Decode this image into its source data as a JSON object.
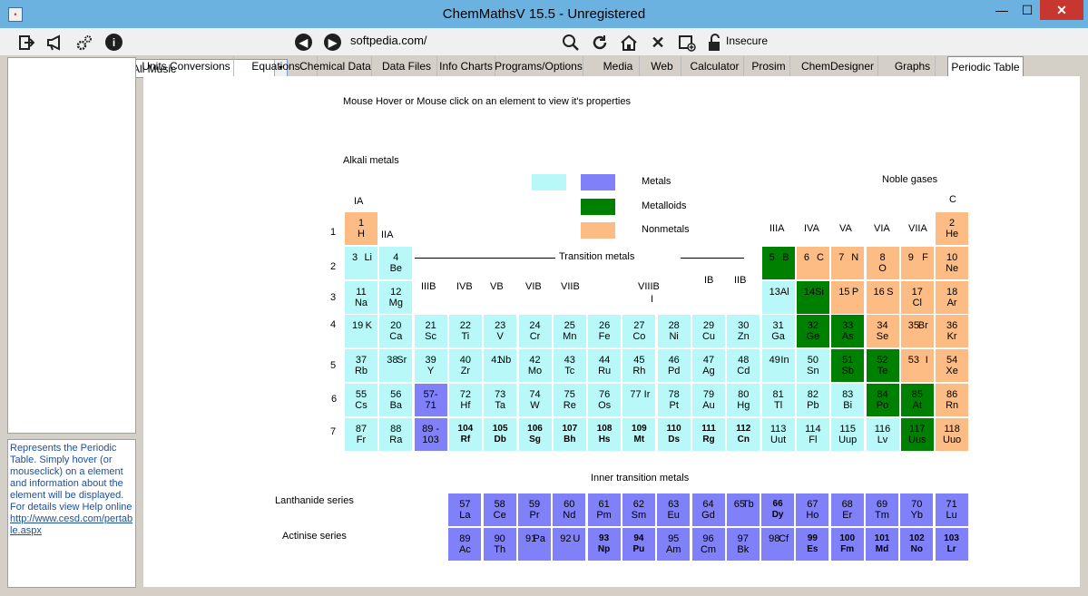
{
  "window": {
    "title": "ChemMathsV 15.5 - Unregistered",
    "min": "—",
    "max": "☐",
    "close": "✕",
    "app_icon": "•"
  },
  "toolbar": {
    "icons": [
      "exit-icon",
      "megaphone-icon",
      "gears-icon",
      "info-icon"
    ],
    "combo_value": "All Music",
    "url": "softpedia.com/",
    "nav_icons": [
      "back-icon",
      "forward-icon",
      "search-icon",
      "refresh-icon",
      "home-icon",
      "stop-icon",
      "new-tab-icon",
      "lock-icon"
    ],
    "insecure_label": "Insecure"
  },
  "help": {
    "text": "Represents the Periodic Table. Simply hover (or mouseclick) on a element and information about the element will be displayed. For details view Help online",
    "link": "http://www.cesd.com/pertable.aspx"
  },
  "tabs": [
    "Units Conversions",
    "Equations",
    "Chemical Data",
    "Data Files",
    "Info Charts",
    "Programs/Options",
    "Media",
    "Web",
    "Calculator",
    "Prosim",
    "ChemDesigner",
    "Graphs",
    "Periodic Table"
  ],
  "active_tab": "Periodic Table",
  "periodic": {
    "instruction": "Mouse Hover or Mouse click on an element to view it's properties",
    "alkali_label": "Alkali metals",
    "noble_label": "Noble gases",
    "legend": {
      "metals": "Metals",
      "metalloids": "Metalloids",
      "nonmetals": "Nonmetals"
    },
    "transition_label": "Transition metals",
    "inner_label": "Inner transition metals",
    "lanthanide_label": "Lanthanide series",
    "actinide_label": "Actinise series",
    "group_labels": [
      "IA",
      "IIA",
      "IIIB",
      "IVB",
      "VB",
      "VIB",
      "VIIB",
      "VIIIB",
      "I",
      "IB",
      "IIB",
      "IIIA",
      "IVA",
      "VA",
      "VIA",
      "VIIA",
      "C"
    ],
    "period_labels": [
      "1",
      "2",
      "3",
      "4",
      "5",
      "6",
      "7"
    ],
    "colors": {
      "metal": "#b8f8f8",
      "inner": "#8080f8",
      "metalloid": "#008000",
      "nonmetal": "#fcbc84"
    },
    "elements": [
      {
        "n": "1",
        "s": "H",
        "c": "nonmetal",
        "r": 1,
        "g": 1
      },
      {
        "n": "2",
        "s": "He",
        "c": "nonmetal",
        "r": 1,
        "g": 18
      },
      {
        "n": "3",
        "s": "Li",
        "c": "metal",
        "r": 2,
        "g": 1,
        "inl": 1
      },
      {
        "n": "4",
        "s": "Be",
        "c": "metal",
        "r": 2,
        "g": 2
      },
      {
        "n": "5",
        "s": "B",
        "c": "metalloid",
        "r": 2,
        "g": 13,
        "inl": 1
      },
      {
        "n": "6",
        "s": "C",
        "c": "nonmetal",
        "r": 2,
        "g": 14,
        "inl": 1
      },
      {
        "n": "7",
        "s": "N",
        "c": "nonmetal",
        "r": 2,
        "g": 15,
        "inl": 1
      },
      {
        "n": "8",
        "s": "O",
        "c": "nonmetal",
        "r": 2,
        "g": 16
      },
      {
        "n": "9",
        "s": "F",
        "c": "nonmetal",
        "r": 2,
        "g": 17,
        "inl": 1
      },
      {
        "n": "10",
        "s": "Ne",
        "c": "nonmetal",
        "r": 2,
        "g": 18
      },
      {
        "n": "11",
        "s": "Na",
        "c": "metal",
        "r": 3,
        "g": 1
      },
      {
        "n": "12",
        "s": "Mg",
        "c": "metal",
        "r": 3,
        "g": 2
      },
      {
        "n": "13",
        "s": "Al",
        "c": "metal",
        "r": 3,
        "g": 13,
        "inl": 1
      },
      {
        "n": "14",
        "s": "Si",
        "c": "metalloid",
        "r": 3,
        "g": 14,
        "inl": 1
      },
      {
        "n": "15",
        "s": "P",
        "c": "nonmetal",
        "r": 3,
        "g": 15,
        "inl": 1
      },
      {
        "n": "16",
        "s": "S",
        "c": "nonmetal",
        "r": 3,
        "g": 16,
        "inl": 1
      },
      {
        "n": "17",
        "s": "Cl",
        "c": "nonmetal",
        "r": 3,
        "g": 17
      },
      {
        "n": "18",
        "s": "Ar",
        "c": "nonmetal",
        "r": 3,
        "g": 18
      },
      {
        "n": "19",
        "s": "K",
        "c": "metal",
        "r": 4,
        "g": 1,
        "inl": 1
      },
      {
        "n": "20",
        "s": "Ca",
        "c": "metal",
        "r": 4,
        "g": 2
      },
      {
        "n": "21",
        "s": "Sc",
        "c": "metal",
        "r": 4,
        "g": 3
      },
      {
        "n": "22",
        "s": "Ti",
        "c": "metal",
        "r": 4,
        "g": 4
      },
      {
        "n": "23",
        "s": "V",
        "c": "metal",
        "r": 4,
        "g": 5
      },
      {
        "n": "24",
        "s": "Cr",
        "c": "metal",
        "r": 4,
        "g": 6
      },
      {
        "n": "25",
        "s": "Mn",
        "c": "metal",
        "r": 4,
        "g": 7
      },
      {
        "n": "26",
        "s": "Fe",
        "c": "metal",
        "r": 4,
        "g": 8
      },
      {
        "n": "27",
        "s": "Co",
        "c": "metal",
        "r": 4,
        "g": 9
      },
      {
        "n": "28",
        "s": "Ni",
        "c": "metal",
        "r": 4,
        "g": 10
      },
      {
        "n": "29",
        "s": "Cu",
        "c": "metal",
        "r": 4,
        "g": 11
      },
      {
        "n": "30",
        "s": "Zn",
        "c": "metal",
        "r": 4,
        "g": 12
      },
      {
        "n": "31",
        "s": "Ga",
        "c": "metal",
        "r": 4,
        "g": 13
      },
      {
        "n": "32",
        "s": "Ge",
        "c": "metalloid",
        "r": 4,
        "g": 14
      },
      {
        "n": "33",
        "s": "As",
        "c": "metalloid",
        "r": 4,
        "g": 15
      },
      {
        "n": "34",
        "s": "Se",
        "c": "nonmetal",
        "r": 4,
        "g": 16
      },
      {
        "n": "35",
        "s": "Br",
        "c": "nonmetal",
        "r": 4,
        "g": 17,
        "inl": 1
      },
      {
        "n": "36",
        "s": "Kr",
        "c": "nonmetal",
        "r": 4,
        "g": 18
      },
      {
        "n": "37",
        "s": "Rb",
        "c": "metal",
        "r": 5,
        "g": 1
      },
      {
        "n": "38",
        "s": "Sr",
        "c": "metal",
        "r": 5,
        "g": 2,
        "inl": 1
      },
      {
        "n": "39",
        "s": "Y",
        "c": "metal",
        "r": 5,
        "g": 3
      },
      {
        "n": "40",
        "s": "Zr",
        "c": "metal",
        "r": 5,
        "g": 4
      },
      {
        "n": "41",
        "s": "Nb",
        "c": "metal",
        "r": 5,
        "g": 5,
        "inl": 1
      },
      {
        "n": "42",
        "s": "Mo",
        "c": "metal",
        "r": 5,
        "g": 6
      },
      {
        "n": "43",
        "s": "Tc",
        "c": "metal",
        "r": 5,
        "g": 7
      },
      {
        "n": "44",
        "s": "Ru",
        "c": "metal",
        "r": 5,
        "g": 8
      },
      {
        "n": "45",
        "s": "Rh",
        "c": "metal",
        "r": 5,
        "g": 9
      },
      {
        "n": "46",
        "s": "Pd",
        "c": "metal",
        "r": 5,
        "g": 10
      },
      {
        "n": "47",
        "s": "Ag",
        "c": "metal",
        "r": 5,
        "g": 11
      },
      {
        "n": "48",
        "s": "Cd",
        "c": "metal",
        "r": 5,
        "g": 12
      },
      {
        "n": "49",
        "s": "In",
        "c": "metal",
        "r": 5,
        "g": 13,
        "inl": 1
      },
      {
        "n": "50",
        "s": "Sn",
        "c": "metal",
        "r": 5,
        "g": 14
      },
      {
        "n": "51",
        "s": "Sb",
        "c": "metalloid",
        "r": 5,
        "g": 15
      },
      {
        "n": "52",
        "s": "Te",
        "c": "metalloid",
        "r": 5,
        "g": 16
      },
      {
        "n": "53",
        "s": "I",
        "c": "nonmetal",
        "r": 5,
        "g": 17,
        "inl": 1
      },
      {
        "n": "54",
        "s": "Xe",
        "c": "nonmetal",
        "r": 5,
        "g": 18
      },
      {
        "n": "55",
        "s": "Cs",
        "c": "metal",
        "r": 6,
        "g": 1
      },
      {
        "n": "56",
        "s": "Ba",
        "c": "metal",
        "r": 6,
        "g": 2
      },
      {
        "n": "57-",
        "s": "71",
        "c": "inner",
        "r": 6,
        "g": 3
      },
      {
        "n": "72",
        "s": "Hf",
        "c": "metal",
        "r": 6,
        "g": 4
      },
      {
        "n": "73",
        "s": "Ta",
        "c": "metal",
        "r": 6,
        "g": 5
      },
      {
        "n": "74",
        "s": "W",
        "c": "metal",
        "r": 6,
        "g": 6
      },
      {
        "n": "75",
        "s": "Re",
        "c": "metal",
        "r": 6,
        "g": 7
      },
      {
        "n": "76",
        "s": "Os",
        "c": "metal",
        "r": 6,
        "g": 8
      },
      {
        "n": "77",
        "s": "Ir",
        "c": "metal",
        "r": 6,
        "g": 9,
        "inl": 1
      },
      {
        "n": "78",
        "s": "Pt",
        "c": "metal",
        "r": 6,
        "g": 10
      },
      {
        "n": "79",
        "s": "Au",
        "c": "metal",
        "r": 6,
        "g": 11
      },
      {
        "n": "80",
        "s": "Hg",
        "c": "metal",
        "r": 6,
        "g": 12
      },
      {
        "n": "81",
        "s": "Tl",
        "c": "metal",
        "r": 6,
        "g": 13
      },
      {
        "n": "82",
        "s": "Pb",
        "c": "metal",
        "r": 6,
        "g": 14
      },
      {
        "n": "83",
        "s": "Bi",
        "c": "metal",
        "r": 6,
        "g": 15
      },
      {
        "n": "84",
        "s": "Po",
        "c": "metalloid",
        "r": 6,
        "g": 16
      },
      {
        "n": "85",
        "s": "At",
        "c": "metalloid",
        "r": 6,
        "g": 17
      },
      {
        "n": "86",
        "s": "Rn",
        "c": "nonmetal",
        "r": 6,
        "g": 18
      },
      {
        "n": "87",
        "s": "Fr",
        "c": "metal",
        "r": 7,
        "g": 1
      },
      {
        "n": "88",
        "s": "Ra",
        "c": "metal",
        "r": 7,
        "g": 2
      },
      {
        "n": "89 -",
        "s": "103",
        "c": "inner",
        "r": 7,
        "g": 3
      },
      {
        "n": "104",
        "s": "Rf",
        "c": "metal",
        "r": 7,
        "g": 4,
        "b": 1
      },
      {
        "n": "105",
        "s": "Db",
        "c": "metal",
        "r": 7,
        "g": 5,
        "b": 1
      },
      {
        "n": "106",
        "s": "Sg",
        "c": "metal",
        "r": 7,
        "g": 6,
        "b": 1
      },
      {
        "n": "107",
        "s": "Bh",
        "c": "metal",
        "r": 7,
        "g": 7,
        "b": 1
      },
      {
        "n": "108",
        "s": "Hs",
        "c": "metal",
        "r": 7,
        "g": 8,
        "b": 1
      },
      {
        "n": "109",
        "s": "Mt",
        "c": "metal",
        "r": 7,
        "g": 9,
        "b": 1
      },
      {
        "n": "110",
        "s": "Ds",
        "c": "metal",
        "r": 7,
        "g": 10,
        "b": 1
      },
      {
        "n": "111",
        "s": "Rg",
        "c": "metal",
        "r": 7,
        "g": 11,
        "b": 1
      },
      {
        "n": "112",
        "s": "Cn",
        "c": "metal",
        "r": 7,
        "g": 12,
        "b": 1
      },
      {
        "n": "113",
        "s": "Uut",
        "c": "metal",
        "r": 7,
        "g": 13
      },
      {
        "n": "114",
        "s": "Fl",
        "c": "metal",
        "r": 7,
        "g": 14
      },
      {
        "n": "115",
        "s": "Uup",
        "c": "metal",
        "r": 7,
        "g": 15
      },
      {
        "n": "116",
        "s": "Lv",
        "c": "metal",
        "r": 7,
        "g": 16
      },
      {
        "n": "117",
        "s": "Uus",
        "c": "metalloid",
        "r": 7,
        "g": 17
      },
      {
        "n": "118",
        "s": "Uuo",
        "c": "nonmetal",
        "r": 7,
        "g": 18
      }
    ],
    "lanthanides": [
      {
        "n": "57",
        "s": "La"
      },
      {
        "n": "58",
        "s": "Ce"
      },
      {
        "n": "59",
        "s": "Pr"
      },
      {
        "n": "60",
        "s": "Nd"
      },
      {
        "n": "61",
        "s": "Pm"
      },
      {
        "n": "62",
        "s": "Sm"
      },
      {
        "n": "63",
        "s": "Eu"
      },
      {
        "n": "64",
        "s": "Gd"
      },
      {
        "n": "65",
        "s": "Tb",
        "inl": 1
      },
      {
        "n": "66",
        "s": "Dy",
        "b": 1
      },
      {
        "n": "67",
        "s": "Ho"
      },
      {
        "n": "68",
        "s": "Er"
      },
      {
        "n": "69",
        "s": "Tm"
      },
      {
        "n": "70",
        "s": "Yb"
      },
      {
        "n": "71",
        "s": "Lu"
      }
    ],
    "actinides": [
      {
        "n": "89",
        "s": "Ac"
      },
      {
        "n": "90",
        "s": "Th"
      },
      {
        "n": "91",
        "s": "Pa",
        "inl": 1
      },
      {
        "n": "92",
        "s": "U",
        "inl": 1
      },
      {
        "n": "93",
        "s": "Np",
        "b": 1
      },
      {
        "n": "94",
        "s": "Pu",
        "b": 1
      },
      {
        "n": "95",
        "s": "Am"
      },
      {
        "n": "96",
        "s": "Cm"
      },
      {
        "n": "97",
        "s": "Bk"
      },
      {
        "n": "98",
        "s": "Cf",
        "inl": 1
      },
      {
        "n": "99",
        "s": "Es",
        "b": 1
      },
      {
        "n": "100",
        "s": "Fm",
        "b": 1
      },
      {
        "n": "101",
        "s": "Md",
        "b": 1
      },
      {
        "n": "102",
        "s": "No",
        "b": 1
      },
      {
        "n": "103",
        "s": "Lr",
        "b": 1
      }
    ]
  }
}
